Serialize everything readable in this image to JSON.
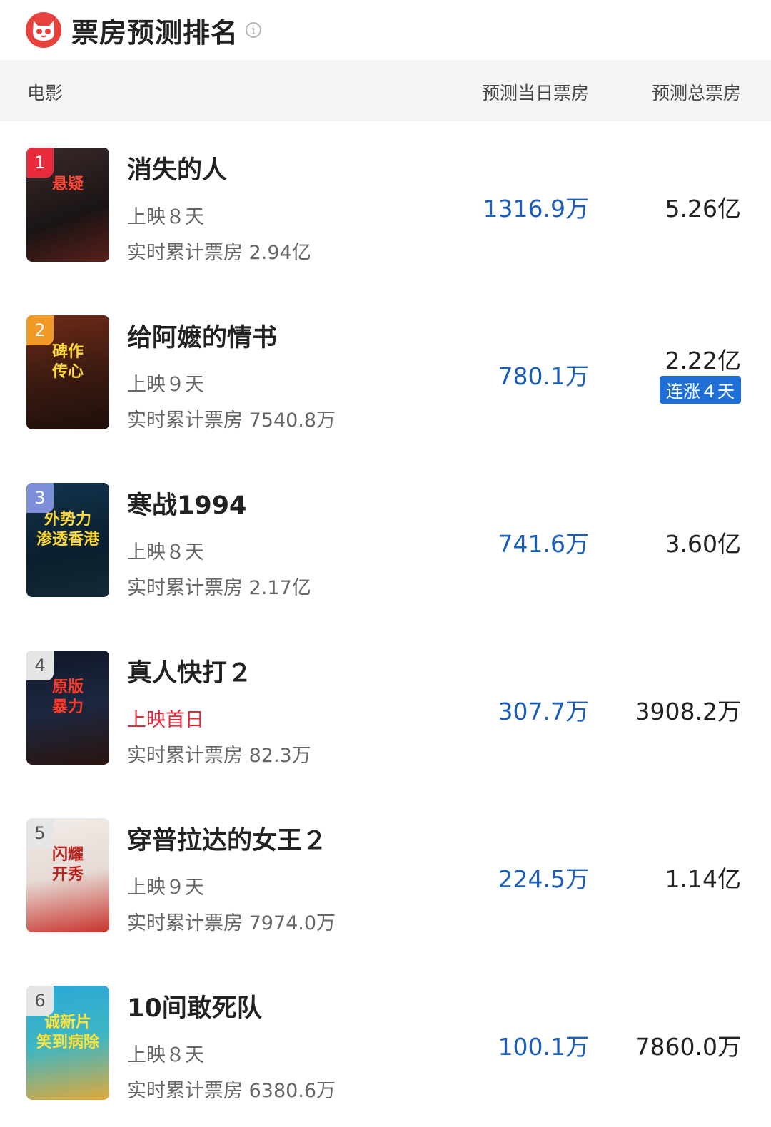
{
  "header": {
    "title": "票房预测排名",
    "info_icon": "info-icon"
  },
  "columns": {
    "movie": "电影",
    "daily": "预测当日票房",
    "total": "预测总票房"
  },
  "colors": {
    "accent_blue": "#1c5fb8",
    "badge_blue": "#1f6fd6",
    "brand_red": "#e8423f",
    "first_day_red": "#e0293a"
  },
  "movies": [
    {
      "rank": "1",
      "name": "消失的人",
      "days": "上映８天",
      "cumulative": "实时累计票房 2.94亿",
      "daily": "1316.9万",
      "total": "5.26亿",
      "badge": ""
    },
    {
      "rank": "2",
      "name": "给阿嬷的情书",
      "days": "上映９天",
      "cumulative": "实时累计票房 7540.8万",
      "daily": "780.1万",
      "total": "2.22亿",
      "badge": "连涨４天"
    },
    {
      "rank": "3",
      "name": "寒战1994",
      "days": "上映８天",
      "cumulative": "实时累计票房 2.17亿",
      "daily": "741.6万",
      "total": "3.60亿",
      "badge": ""
    },
    {
      "rank": "4",
      "name": "真人快打２",
      "days": "上映首日",
      "cumulative": "实时累计票房 82.3万",
      "daily": "307.7万",
      "total": "3908.2万",
      "badge": ""
    },
    {
      "rank": "5",
      "name": "穿普拉达的女王２",
      "days": "上映９天",
      "cumulative": "实时累计票房 7974.0万",
      "daily": "224.5万",
      "total": "1.14亿",
      "badge": ""
    },
    {
      "rank": "6",
      "name": "10间敢死队",
      "days": "上映８天",
      "cumulative": "实时累计票房 6380.6万",
      "daily": "100.1万",
      "total": "7860.0万",
      "badge": ""
    }
  ]
}
